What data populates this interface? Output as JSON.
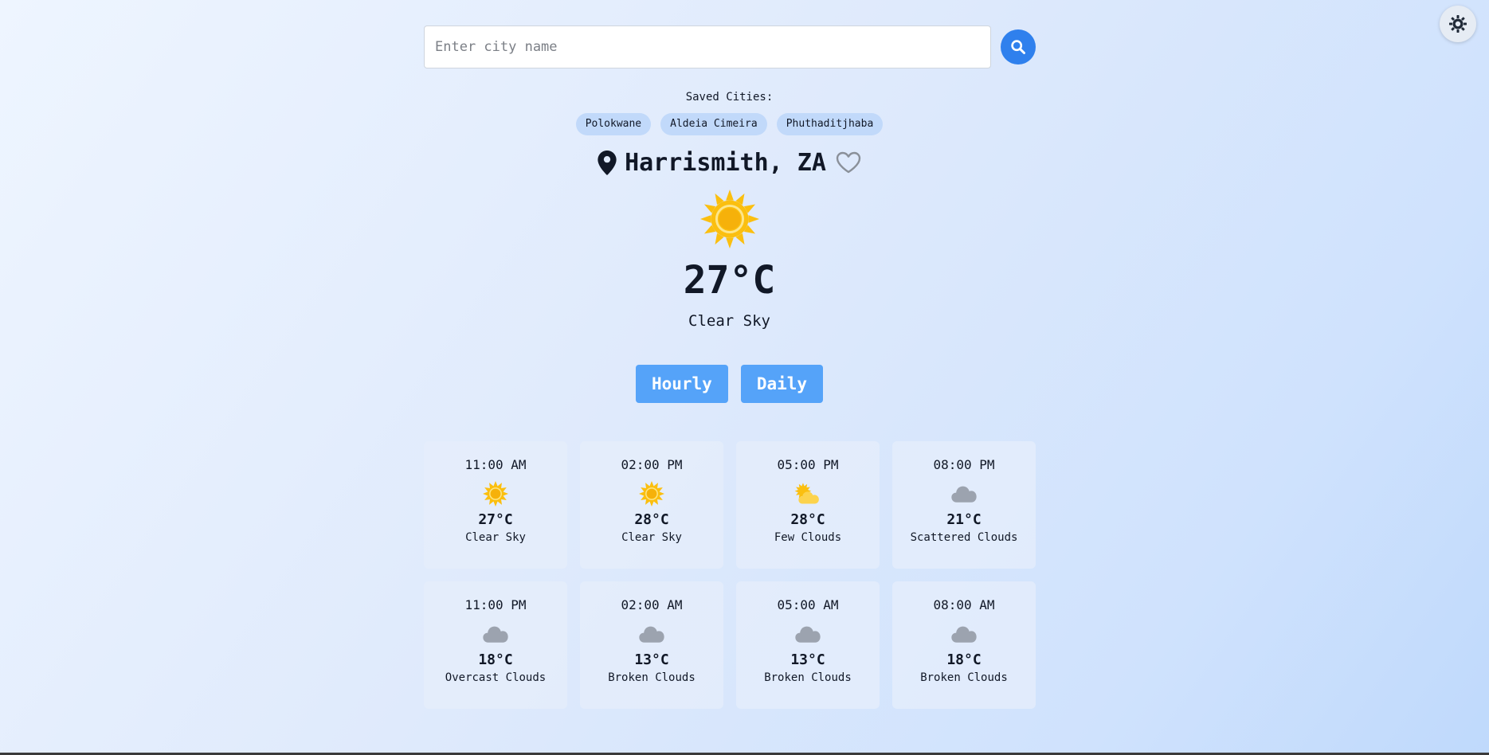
{
  "search": {
    "placeholder": "Enter city name",
    "value": "",
    "button_icon": "search-icon"
  },
  "theme_toggle": {
    "icon": "sun-settings-icon"
  },
  "saved": {
    "label": "Saved Cities:",
    "cities": [
      "Polokwane",
      "Aldeia Cimeira",
      "Phuthaditjhaba"
    ]
  },
  "current": {
    "location": "Harrismith, ZA",
    "icon": "sun-icon",
    "temperature": "27°C",
    "description": "Clear Sky"
  },
  "tabs": {
    "hourly": "Hourly",
    "daily": "Daily"
  },
  "forecast": [
    {
      "time": "11:00 AM",
      "temp": "27°C",
      "desc": "Clear Sky",
      "icon": "sun"
    },
    {
      "time": "02:00 PM",
      "temp": "28°C",
      "desc": "Clear Sky",
      "icon": "sun"
    },
    {
      "time": "05:00 PM",
      "temp": "28°C",
      "desc": "Few Clouds",
      "icon": "sun-cloud"
    },
    {
      "time": "08:00 PM",
      "temp": "21°C",
      "desc": "Scattered Clouds",
      "icon": "cloud"
    },
    {
      "time": "11:00 PM",
      "temp": "18°C",
      "desc": "Overcast Clouds",
      "icon": "cloud"
    },
    {
      "time": "02:00 AM",
      "temp": "13°C",
      "desc": "Broken Clouds",
      "icon": "cloud"
    },
    {
      "time": "05:00 AM",
      "temp": "13°C",
      "desc": "Broken Clouds",
      "icon": "cloud"
    },
    {
      "time": "08:00 AM",
      "temp": "18°C",
      "desc": "Broken Clouds",
      "icon": "cloud"
    }
  ],
  "colors": {
    "accent": "#2f80ed",
    "tab": "#55a3f9",
    "chip": "#c1d9fa",
    "sun": "#fbbf0f",
    "sun_center": "#f6b10a",
    "cloud": "#9ca3af"
  }
}
